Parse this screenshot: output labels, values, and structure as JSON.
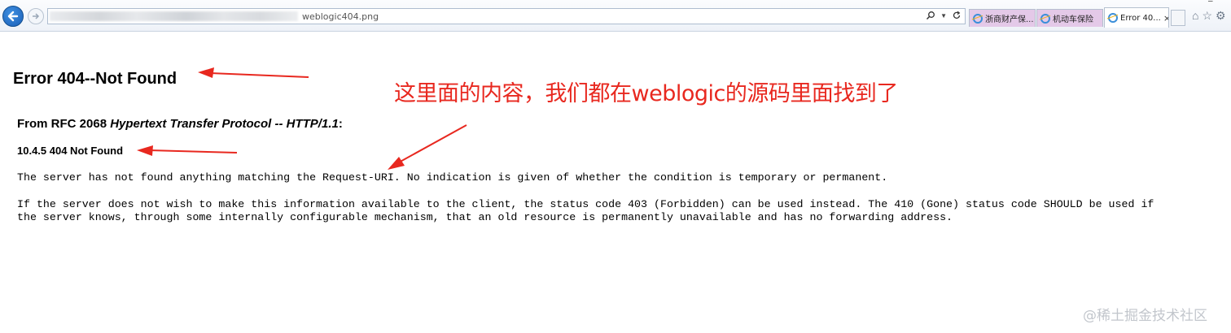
{
  "browser": {
    "url_visible_suffix": "weblogic404.png",
    "tabs": [
      {
        "label": "浙商财产保...",
        "state": "inactive"
      },
      {
        "label": "机动车保险",
        "state": "inactive"
      },
      {
        "label": "Error 40...",
        "state": "active",
        "close": "×"
      }
    ],
    "address_tools": [
      "search-icon",
      "dropdown-icon",
      "refresh-icon"
    ],
    "right_icons": [
      "home-icon",
      "favorites-icon",
      "settings-icon"
    ]
  },
  "page": {
    "title": "Error 404--Not Found",
    "rfc_prefix": "From RFC 2068 ",
    "rfc_italic": "Hypertext Transfer Protocol -- HTTP/1.1",
    "rfc_suffix": ":",
    "section": "10.4.5 404 Not Found",
    "para1": "The server has not found anything matching the Request-URI. No indication is given of whether the condition is temporary or permanent.",
    "para2_line1": "If the server does not wish to make this information available to the client, the status code 403 (Forbidden) can be used instead. The 410 (Gone) status code SHOULD be used if",
    "para2_line2": "the server knows, through some internally configurable mechanism, that an old resource is permanently unavailable and has no forwarding address."
  },
  "annotation": {
    "text": "这里面的内容，我们都在weblogic的源码里面找到了",
    "color": "#e8281f"
  },
  "watermark": "@稀土掘金技术社区"
}
